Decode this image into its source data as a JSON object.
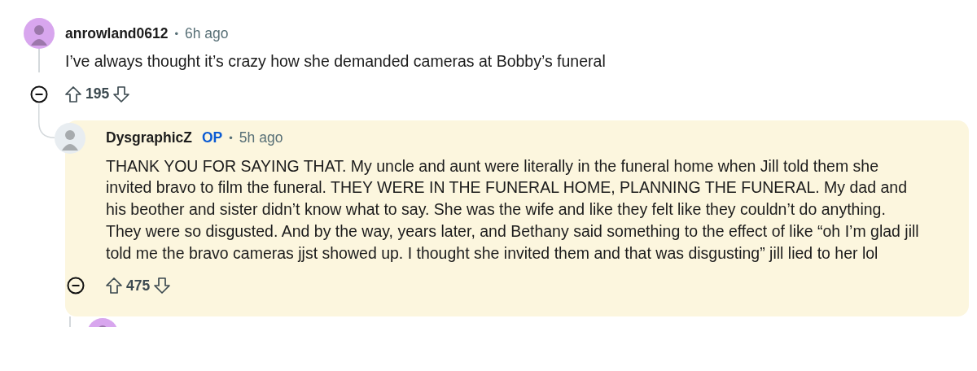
{
  "comments": [
    {
      "kind": "comment",
      "author": "anrowland0612",
      "separator": "•",
      "time": "6h ago",
      "highlighted": false,
      "avatar": {
        "color": "#d8a6ee"
      },
      "body": "I’ve always thought it’s crazy how she demanded cameras at Bobby’s funeral",
      "score": "195",
      "children": [
        {
          "kind": "comment",
          "author": "DysgraphicZ",
          "badge": "OP",
          "separator": "•",
          "time": "5h ago",
          "highlighted": true,
          "avatar": {
            "color": "#e8edf1"
          },
          "body": "THANK YOU FOR SAYING THAT. My uncle and aunt were literally in the funeral home when Jill told them she invited bravo to film the funeral. THEY WERE IN THE FUNERAL HOME, PLANNING THE FUNERAL. My dad and his beother and sister didn’t know what to say. She was the wife and like they felt like they couldn’t do anything. They were so disgusted. And by the way, years later, and Bethany said something to the effect of like “oh I’m glad jill told me the bravo cameras jjst showed up. I thought she invited them and that was disgusting” jill lied to her lol",
          "score": "475",
          "children": [
            {
              "kind": "cut_off",
              "avatar": {
                "color": "#d8a6ee"
              }
            }
          ]
        }
      ]
    }
  ]
}
